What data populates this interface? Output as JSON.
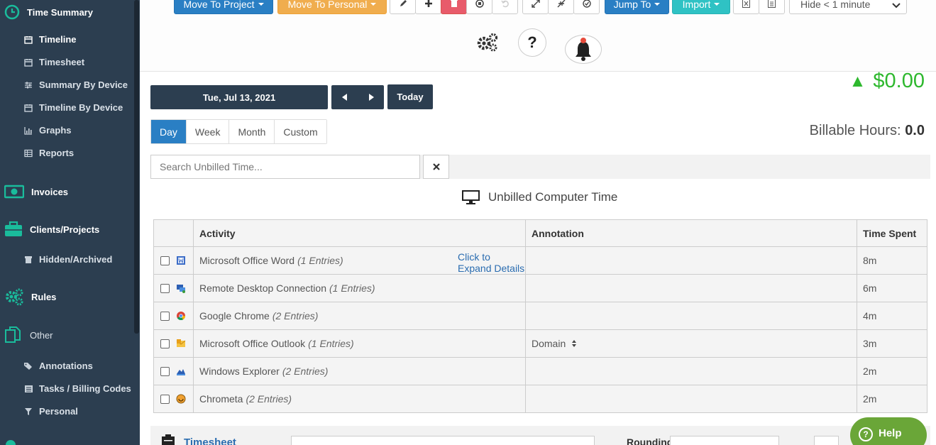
{
  "sidebar": {
    "time_summary": "Time Summary",
    "items": [
      {
        "label": "Timeline",
        "icon": "calendar-icon"
      },
      {
        "label": "Timesheet",
        "icon": "calendar-icon"
      },
      {
        "label": "Summary By Device",
        "icon": "sliders-icon"
      },
      {
        "label": "Timeline By Device",
        "icon": "calendar-icon"
      },
      {
        "label": "Graphs",
        "icon": "bar-chart-icon"
      },
      {
        "label": "Reports",
        "icon": "table-icon"
      }
    ],
    "invoices": "Invoices",
    "clients_projects": "Clients/Projects",
    "hidden_archived": "Hidden/Archived",
    "rules": "Rules",
    "other": "Other",
    "other_items": [
      {
        "label": "Annotations",
        "icon": "tags-icon"
      },
      {
        "label": "Tasks / Billing Codes",
        "icon": "list-icon"
      },
      {
        "label": "Personal",
        "icon": "filter-icon"
      }
    ]
  },
  "toolbar": {
    "move_to_project": "Move To Project",
    "move_to_personal": "Move To Personal",
    "jump_to": "Jump To",
    "import": "Import",
    "hide_select": "Hide < 1 minute"
  },
  "date": {
    "current": "Tue, Jul 13, 2021",
    "today": "Today"
  },
  "money": "$0.00",
  "tabs": [
    "Day",
    "Week",
    "Month",
    "Custom"
  ],
  "billable": {
    "label": "Billable Hours:",
    "value": "0.0"
  },
  "search": {
    "placeholder": "Search Unbilled Time..."
  },
  "section_title": "Unbilled Computer Time",
  "table": {
    "headers": [
      "Activity",
      "Annotation",
      "Time Spent"
    ],
    "expand_link": "Click to Expand Details",
    "rows": [
      {
        "app": "Microsoft Office Word",
        "entries": "(1 Entries)",
        "annotation": "",
        "time": "8m",
        "icon": "word-icon"
      },
      {
        "app": "Remote Desktop Connection",
        "entries": "(1 Entries)",
        "annotation": "",
        "time": "6m",
        "icon": "remote-desktop-icon"
      },
      {
        "app": "Google Chrome",
        "entries": "(2 Entries)",
        "annotation": "",
        "time": "4m",
        "icon": "chrome-icon"
      },
      {
        "app": "Microsoft Office Outlook",
        "entries": "(1 Entries)",
        "annotation": "Domain",
        "time": "3m",
        "icon": "outlook-icon"
      },
      {
        "app": "Windows Explorer",
        "entries": "(2 Entries)",
        "annotation": "",
        "time": "2m",
        "icon": "explorer-icon"
      },
      {
        "app": "Chrometa",
        "entries": "(2 Entries)",
        "annotation": "",
        "time": "2m",
        "icon": "chrometa-icon"
      }
    ]
  },
  "bottom": {
    "timesheet": "Timesheet",
    "rounding": "Rounding"
  },
  "help": "Help",
  "colors": {
    "sidebar_bg": "#2c3e50",
    "accent_teal": "#1abc9c",
    "primary_blue": "#2a7fc4",
    "money_green": "#2eb82e",
    "help_green": "#6aa638"
  }
}
